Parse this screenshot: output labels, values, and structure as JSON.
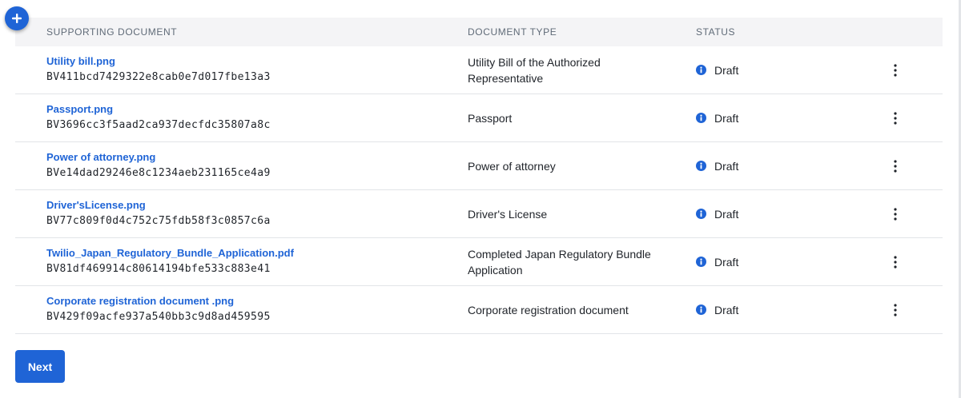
{
  "table": {
    "headers": {
      "document": "SUPPORTING DOCUMENT",
      "type": "DOCUMENT TYPE",
      "status": "STATUS"
    },
    "rows": [
      {
        "file": "Utility bill.png",
        "sid": "BV411bcd7429322e8cab0e7d017fbe13a3",
        "type": "Utility Bill of the Authorized Representative",
        "status": "Draft"
      },
      {
        "file": "Passport.png",
        "sid": "BV3696cc3f5aad2ca937decfdc35807a8c",
        "type": "Passport",
        "status": "Draft"
      },
      {
        "file": "Power of attorney.png",
        "sid": "BVe14dad29246e8c1234aeb231165ce4a9",
        "type": "Power of attorney",
        "status": "Draft"
      },
      {
        "file": "Driver'sLicense.png",
        "sid": "BV77c809f0d4c752c75fdb58f3c0857c6a",
        "type": "Driver's License",
        "status": "Draft"
      },
      {
        "file": "Twilio_Japan_Regulatory_Bundle_Application.pdf",
        "sid": "BV81df469914c80614194bfe533c883e41",
        "type": "Completed Japan Regulatory Bundle Application",
        "status": "Draft"
      },
      {
        "file": "Corporate registration document .png",
        "sid": "BV429f09acfe937a540bb3c9d8ad459595",
        "type": "Corporate registration document",
        "status": "Draft"
      }
    ]
  },
  "actions": {
    "next_label": "Next"
  },
  "icons": {
    "add": "plus-icon",
    "status": "info-icon",
    "menu": "more-vertical-icon"
  },
  "colors": {
    "accent": "#1f64d6",
    "header_bg": "#f4f4f6",
    "row_border": "#e2e4e8"
  }
}
